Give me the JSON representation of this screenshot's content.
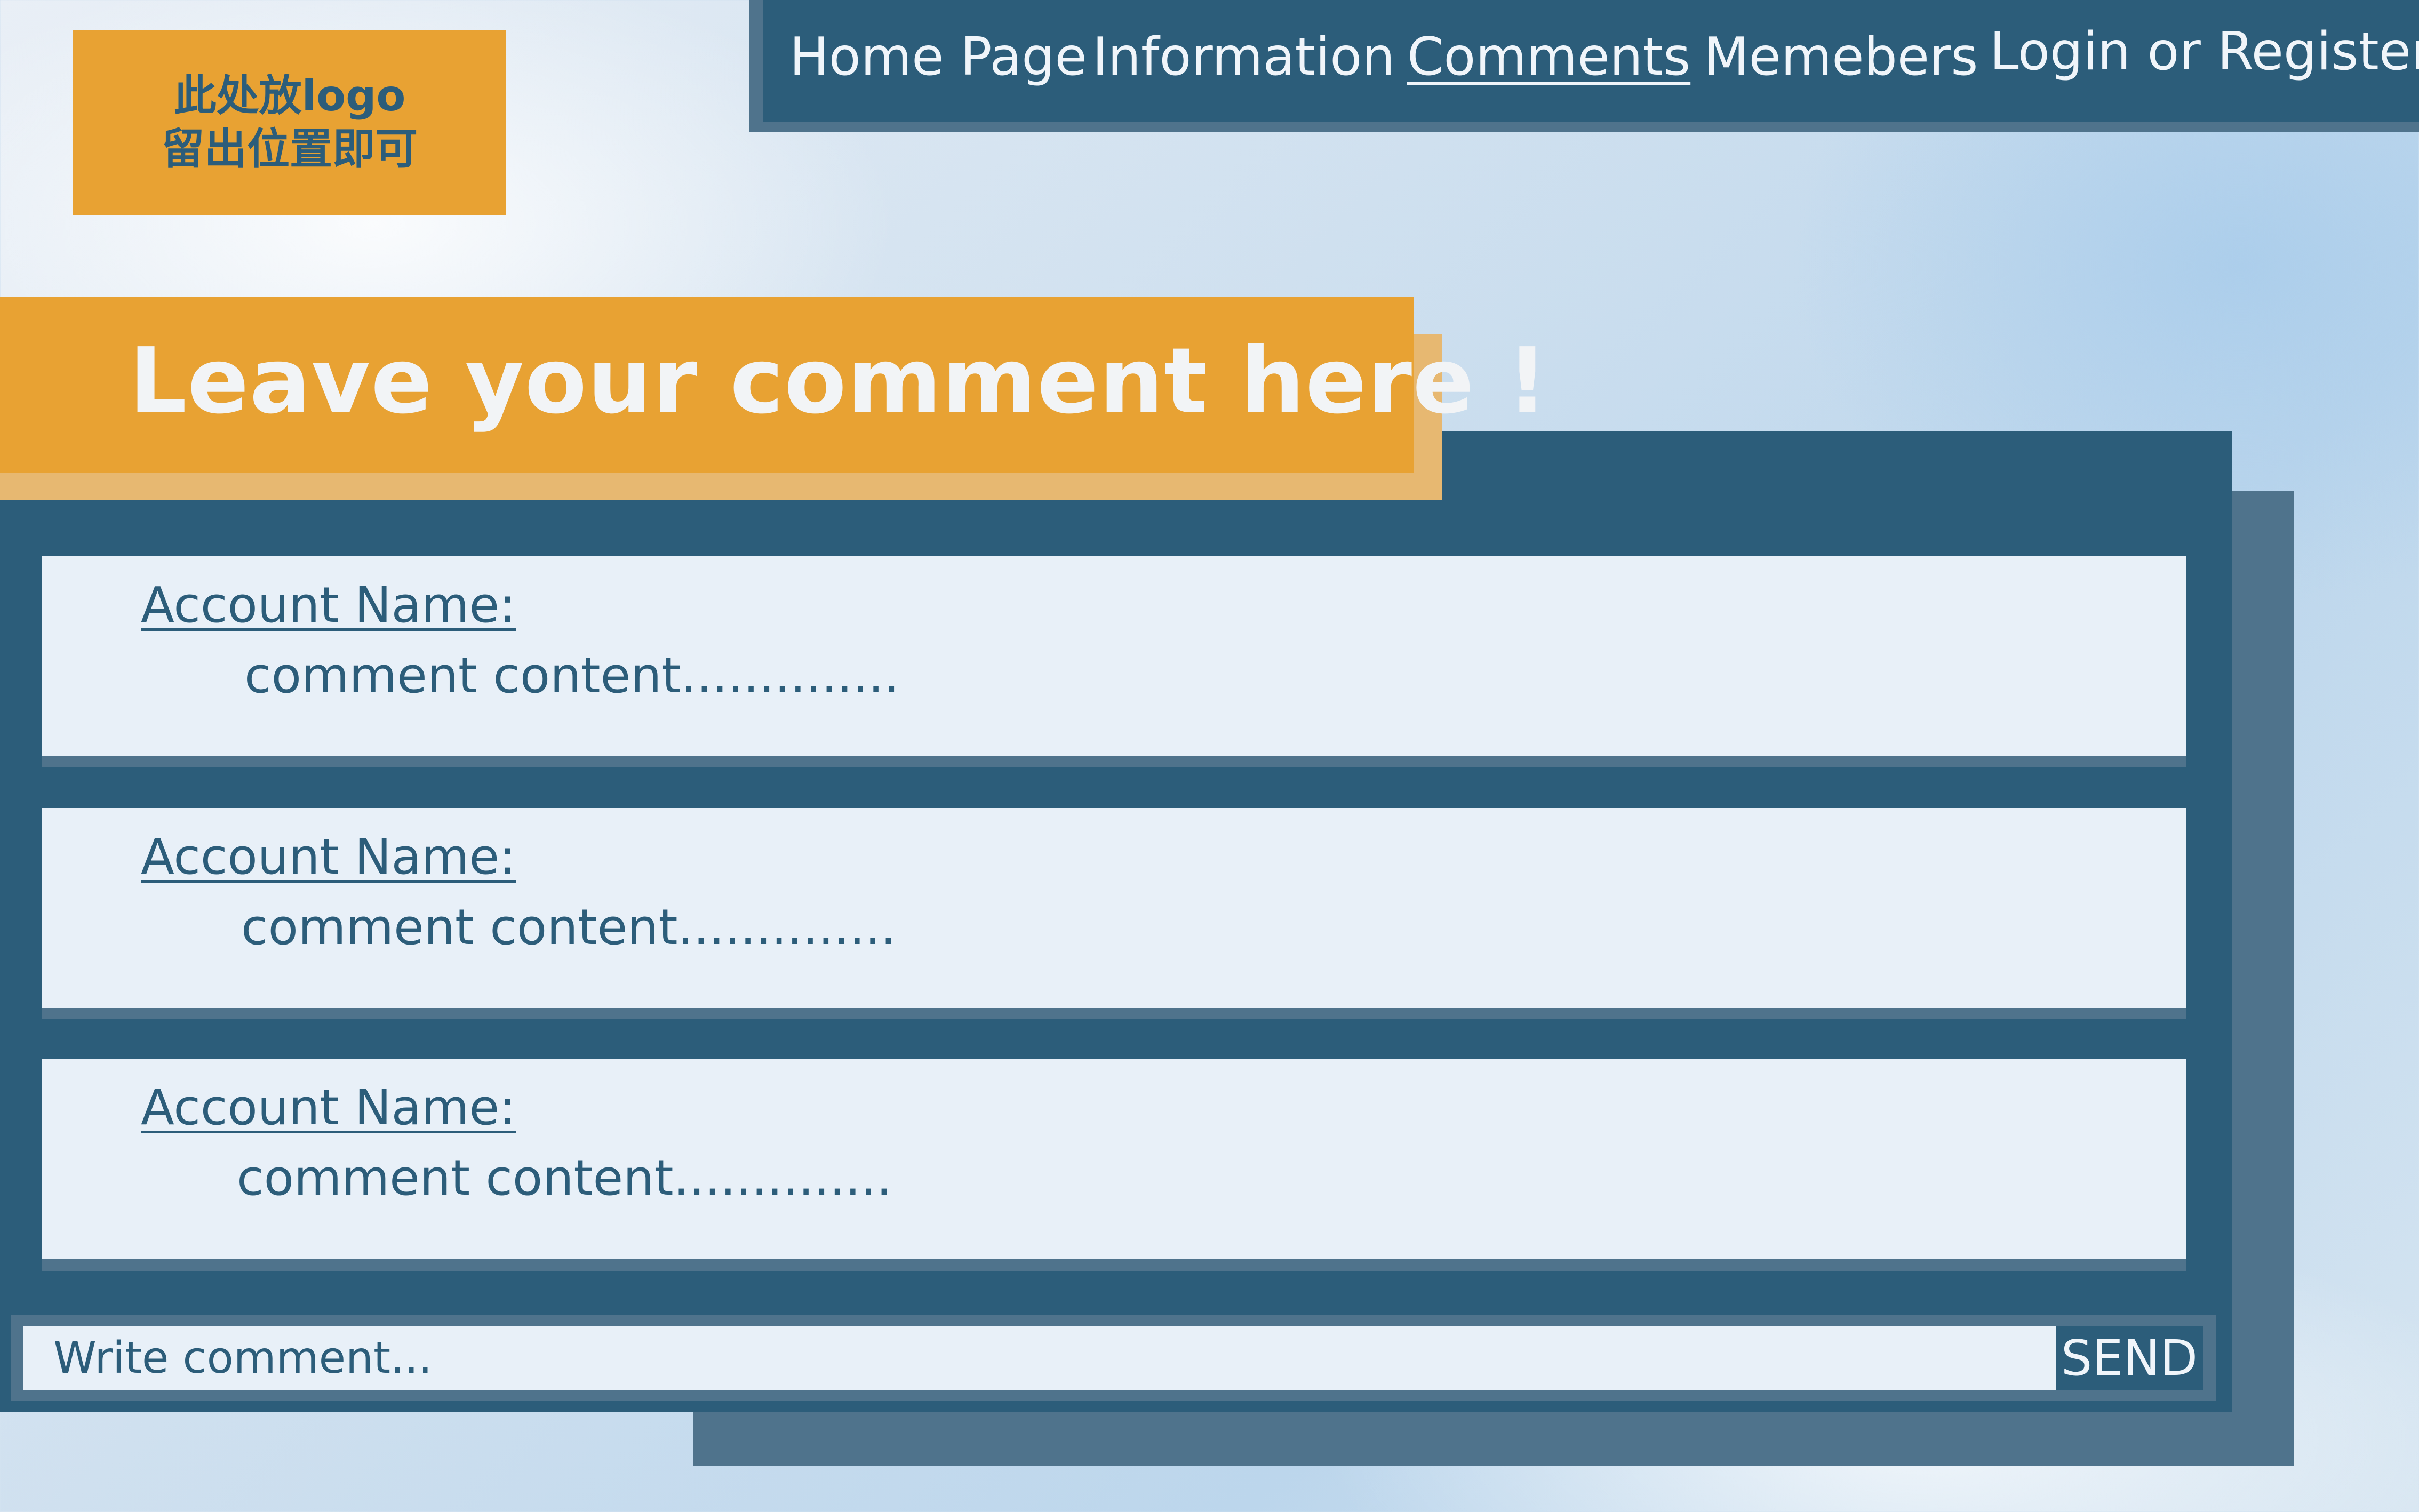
{
  "logo": {
    "line1": "此处放logo",
    "line2": "留出位置即可"
  },
  "nav": {
    "items": [
      {
        "label": "Home Page"
      },
      {
        "label": "Information"
      },
      {
        "label": "Comments",
        "active": true
      },
      {
        "label": "Memebers"
      },
      {
        "label": "Login or Register"
      }
    ]
  },
  "banner": {
    "title": "Leave your comment here !"
  },
  "comments": [
    {
      "account": "Account Name:",
      "content": "comment content.............."
    },
    {
      "account": "Account Name:",
      "content": "comment content.............."
    },
    {
      "account": "Account Name:",
      "content": "comment content.............."
    }
  ],
  "composer": {
    "placeholder": "Write comment...",
    "send_label": "SEND"
  },
  "colors": {
    "navy": "#2c5d7a",
    "slate": "#4f738c",
    "orange": "#e8a233",
    "card": "#e8f0f8"
  }
}
